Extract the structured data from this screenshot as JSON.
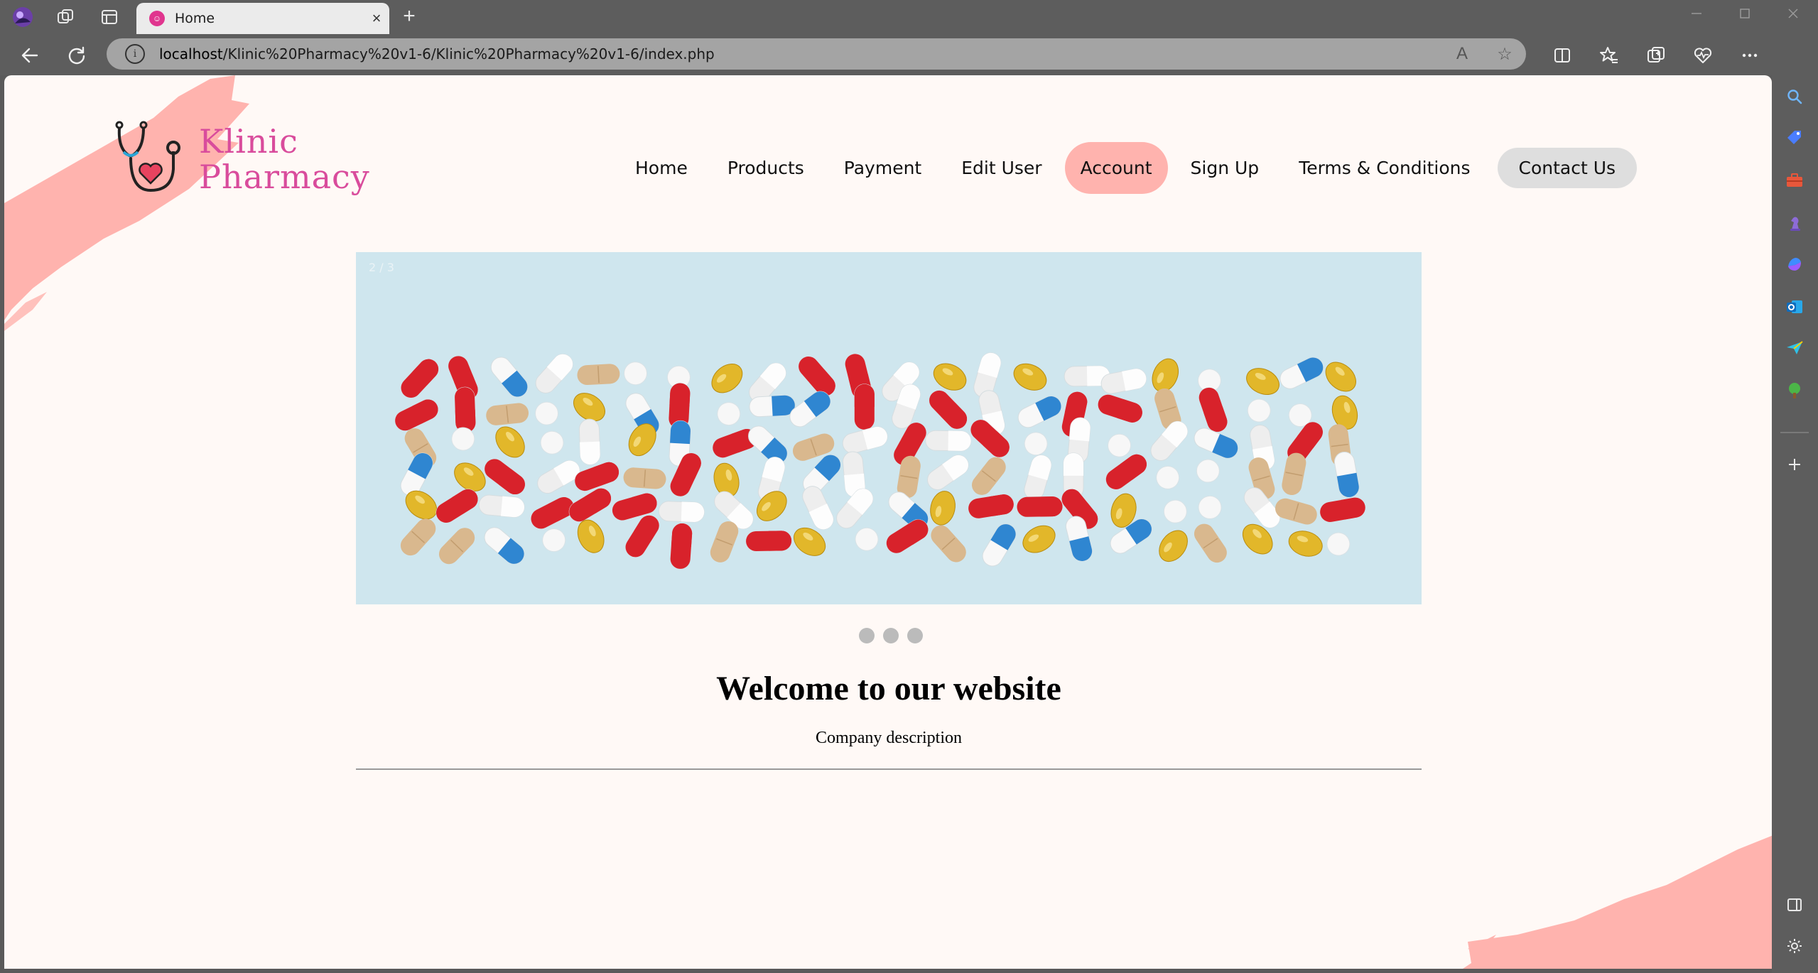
{
  "browser": {
    "tab_title": "Home",
    "favicon_text": "☺",
    "close_glyph": "×",
    "newtab_glyph": "+",
    "address_host": "localhost",
    "address_path": "/Klinic%20Pharmacy%20v1-6/Klinic%20Pharmacy%20v1-6/index.php",
    "info_glyph": "i",
    "read_aloud_glyph": "A",
    "favorite_glyph": "☆"
  },
  "site": {
    "logo_line1": "Klinic",
    "logo_line2": "Pharmacy",
    "nav": [
      {
        "label": "Home"
      },
      {
        "label": "Products"
      },
      {
        "label": "Payment"
      },
      {
        "label": "Edit User"
      },
      {
        "label": "Account"
      },
      {
        "label": "Sign Up"
      },
      {
        "label": "Terms & Conditions"
      },
      {
        "label": "Contact Us"
      }
    ],
    "slide_counter": "2 / 3",
    "welcome": "Welcome to our website",
    "company": "Company description"
  },
  "colors": {
    "accent_pink": "#ffb3ae",
    "logo_pink": "#d94c9c",
    "page_bg": "#fff9f6"
  },
  "icons": {
    "back": "back-arrow-icon",
    "refresh": "refresh-icon",
    "split": "split-screen-icon",
    "favorites": "favorites-icon",
    "collections": "collections-icon",
    "performance": "heart-pulse-icon",
    "more": "more-icon",
    "copilot": "copilot-icon"
  }
}
